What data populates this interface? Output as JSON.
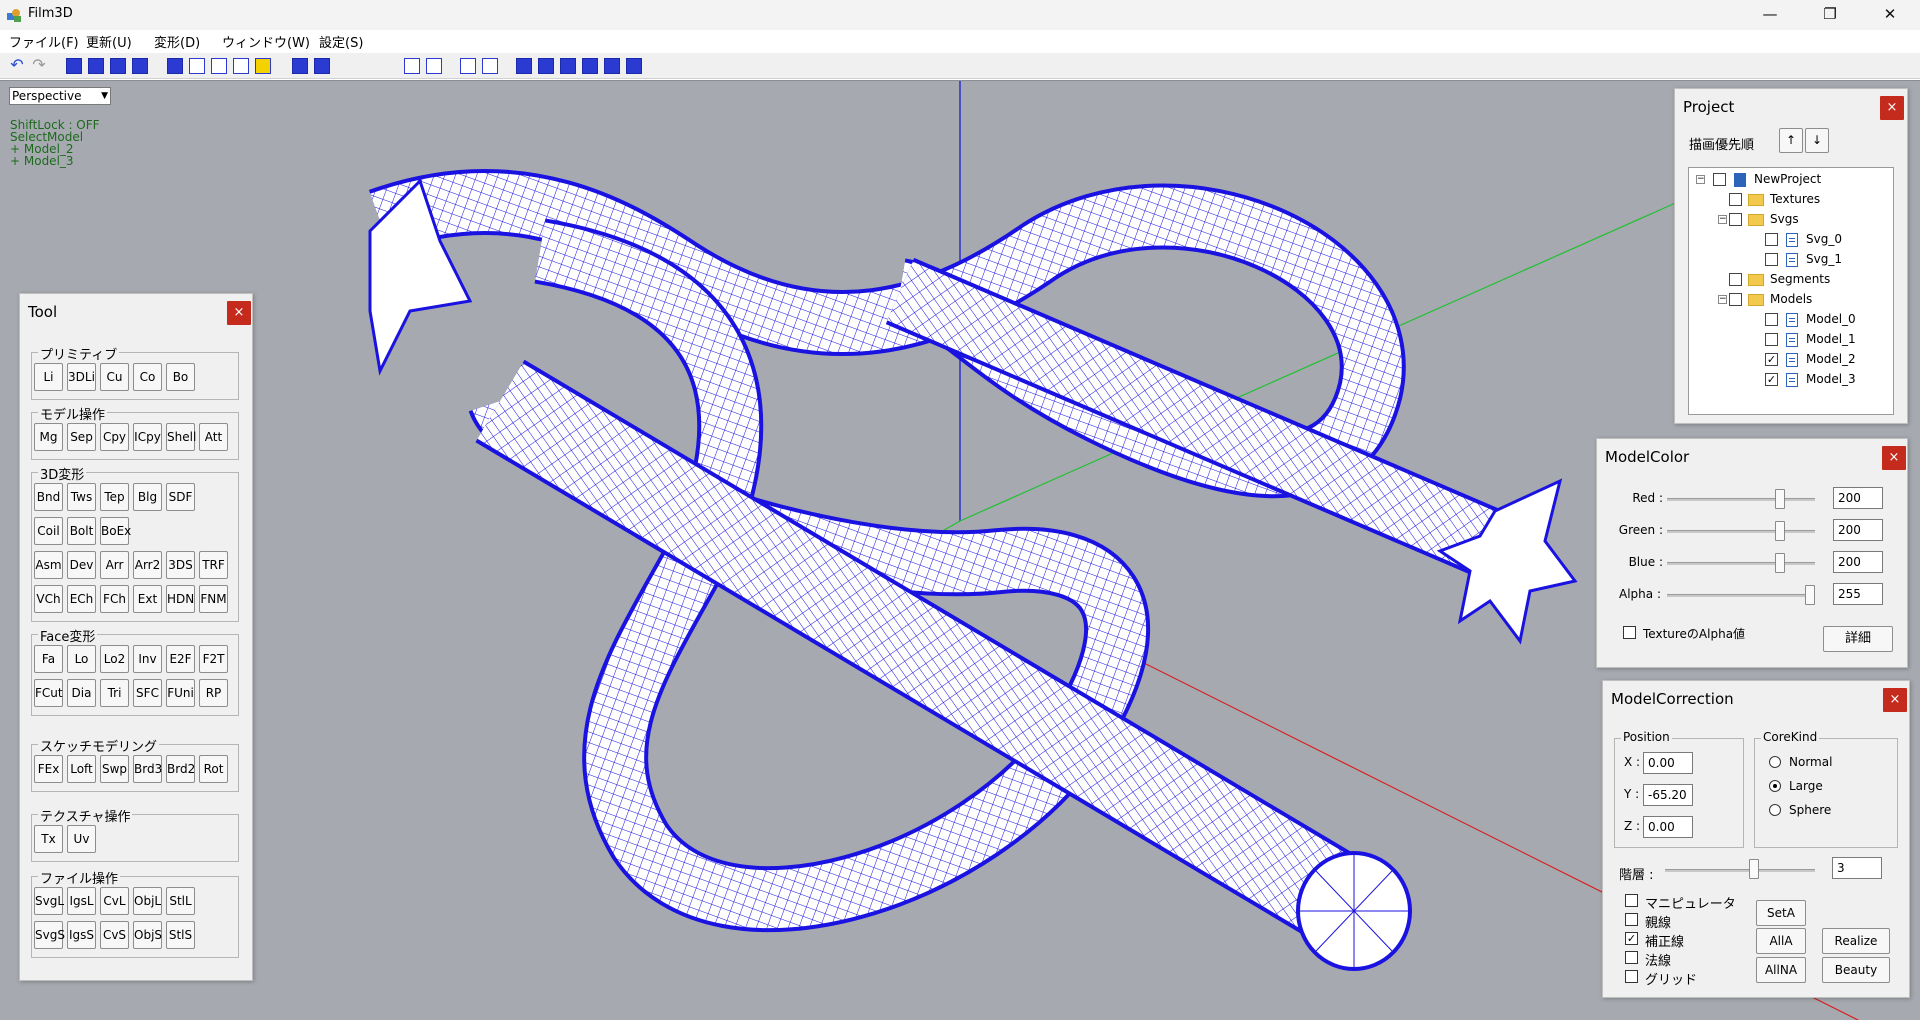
{
  "window": {
    "title": "Film3D",
    "minimize": "—",
    "maximize": "❐",
    "close": "✕"
  },
  "menu": [
    "ファイル(F)",
    "更新(U)",
    "変形(D)",
    "ウィンドウ(W)",
    "設定(S)"
  ],
  "viewport": {
    "view_mode": "Perspective",
    "status_lines": [
      "ShiftLock : OFF",
      "SelectModel",
      "+ Model_2",
      "+ Model_3"
    ]
  },
  "tool_panel": {
    "title": "Tool",
    "close": "×",
    "groups": [
      {
        "label": "プリミティブ",
        "rows": [
          [
            "Li",
            "3DLi",
            "Cu",
            "Co",
            "Bo"
          ]
        ]
      },
      {
        "label": "モデル操作",
        "rows": [
          [
            "Mg",
            "Sep",
            "Cpy",
            "ICpy",
            "Shell",
            "Att"
          ]
        ]
      },
      {
        "label": "3D変形",
        "rows": [
          [
            "Bnd",
            "Tws",
            "Tep",
            "Blg",
            "SDF"
          ],
          [
            "Coil",
            "Bolt",
            "BoEx"
          ],
          [
            "Asm",
            "Dev",
            "Arr",
            "Arr2",
            "3DS",
            "TRF"
          ],
          [
            "VCh",
            "ECh",
            "FCh",
            "Ext",
            "HDN",
            "FNM"
          ]
        ]
      },
      {
        "label": "Face変形",
        "rows": [
          [
            "Fa",
            "Lo",
            "Lo2",
            "Inv",
            "E2F",
            "F2T"
          ],
          [
            "FCut",
            "Dia",
            "Tri",
            "SFC",
            "FUni",
            "RP"
          ]
        ]
      },
      {
        "label": "スケッチモデリング",
        "rows": [
          [
            "FEx",
            "Loft",
            "Swp",
            "Brd3",
            "Brd2",
            "Rot"
          ]
        ]
      },
      {
        "label": "テクスチャ操作",
        "rows": [
          [
            "Tx",
            "Uv"
          ]
        ]
      },
      {
        "label": "ファイル操作",
        "rows": [
          [
            "SvgL",
            "IgsL",
            "CvL",
            "ObjL",
            "StlL"
          ],
          [
            "SvgS",
            "IgsS",
            "CvS",
            "ObjS",
            "StlS"
          ]
        ]
      }
    ]
  },
  "project_panel": {
    "title": "Project",
    "close": "×",
    "priority_label": "描画優先順",
    "up": "↑",
    "down": "↓",
    "tree": [
      {
        "label": "NewProject",
        "level": 0,
        "kind": "root",
        "checked": false,
        "expander": "−"
      },
      {
        "label": "Textures",
        "level": 1,
        "kind": "folder",
        "checked": false
      },
      {
        "label": "Svgs",
        "level": 1,
        "kind": "folder",
        "checked": false,
        "expander": "−"
      },
      {
        "label": "Svg_0",
        "level": 2,
        "kind": "file",
        "checked": false
      },
      {
        "label": "Svg_1",
        "level": 2,
        "kind": "file",
        "checked": false
      },
      {
        "label": "Segments",
        "level": 1,
        "kind": "folder",
        "checked": false
      },
      {
        "label": "Models",
        "level": 1,
        "kind": "folder",
        "checked": false,
        "expander": "−"
      },
      {
        "label": "Model_0",
        "level": 2,
        "kind": "file",
        "checked": false
      },
      {
        "label": "Model_1",
        "level": 2,
        "kind": "file",
        "checked": false
      },
      {
        "label": "Model_2",
        "level": 2,
        "kind": "file",
        "checked": true
      },
      {
        "label": "Model_3",
        "level": 2,
        "kind": "file",
        "checked": true
      }
    ]
  },
  "color_panel": {
    "title": "ModelColor",
    "close": "×",
    "channels": [
      {
        "label": "Red :",
        "value": "200",
        "level": 0.784
      },
      {
        "label": "Green :",
        "value": "200",
        "level": 0.784
      },
      {
        "label": "Blue :",
        "value": "200",
        "level": 0.784
      },
      {
        "label": "Alpha :",
        "value": "255",
        "level": 1.0
      }
    ],
    "texture_alpha": "TextureのAlpha値",
    "detail": "詳細"
  },
  "correction_panel": {
    "title": "ModelCorrection",
    "close": "×",
    "position_label": "Position",
    "x_label": "X :",
    "x": "0.00",
    "y_label": "Y :",
    "y": "-65.20",
    "z_label": "Z :",
    "z": "0.00",
    "corekind_label": "CoreKind",
    "kinds": [
      {
        "label": "Normal",
        "selected": false
      },
      {
        "label": "Large",
        "selected": true
      },
      {
        "label": "Sphere",
        "selected": false
      }
    ],
    "layer_label": "階層 :",
    "layer_value": "3",
    "layer_level": 0.6,
    "options": [
      {
        "label": "マニピュレータ",
        "checked": false
      },
      {
        "label": "親線",
        "checked": false
      },
      {
        "label": "補正線",
        "checked": true
      },
      {
        "label": "法線",
        "checked": false
      },
      {
        "label": "グリッド",
        "checked": false
      }
    ],
    "buttons": {
      "seta": "SetA",
      "alla": "AllA",
      "allna": "AllNA",
      "realize": "Realize",
      "beauty": "Beauty"
    }
  },
  "colors": {
    "mesh": "#1a12e0",
    "viewport_bg": "#a6aab0",
    "axis_x": "#d82020",
    "axis_y": "#20c030",
    "axis_z": "#1010d0"
  }
}
